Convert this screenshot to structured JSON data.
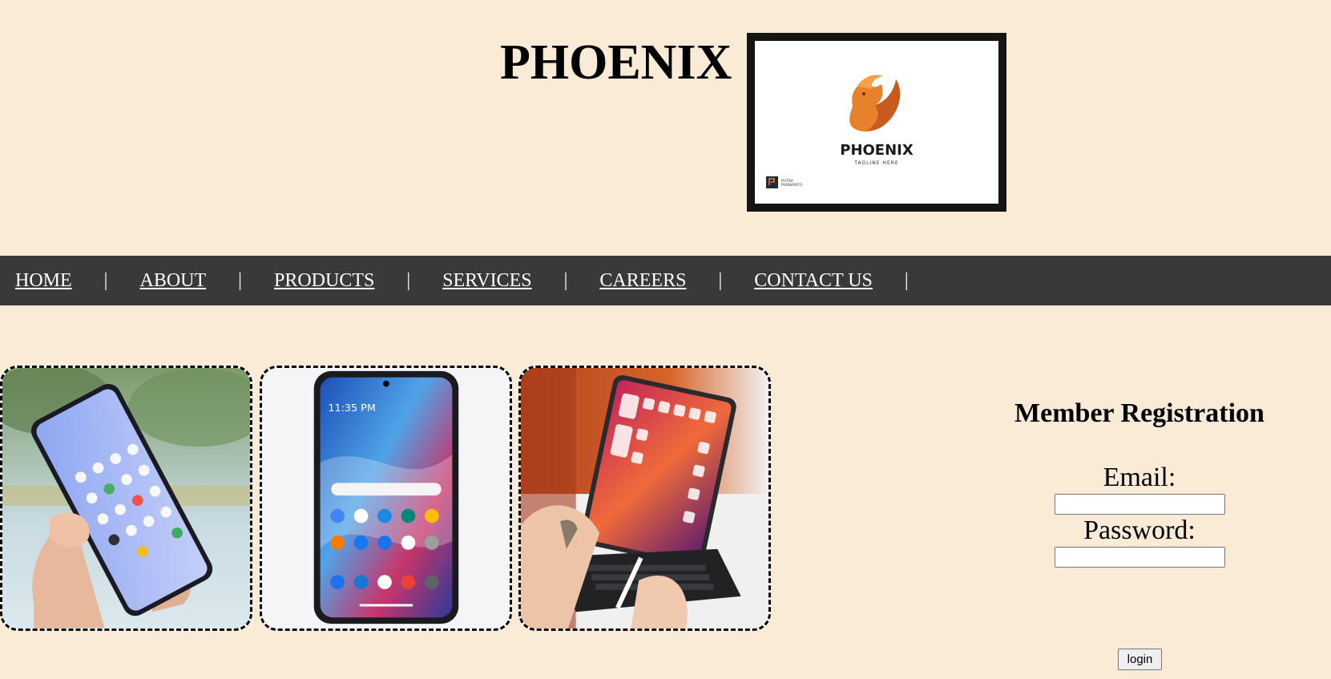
{
  "header": {
    "title": "PHOENIX",
    "logo": {
      "brand": "PHOENIX",
      "tagline": "TAGLINE HERE",
      "credit_line_1": "PUTRA",
      "credit_line_2": "PURWANTO",
      "accent_color": "#e8812c"
    }
  },
  "nav": {
    "separator": "|",
    "items": [
      {
        "label": "HOME"
      },
      {
        "label": "ABOUT"
      },
      {
        "label": "PRODUCTS"
      },
      {
        "label": "SERVICES"
      },
      {
        "label": "CAREERS"
      },
      {
        "label": "CONTACT US"
      }
    ]
  },
  "products": {
    "phone_1": {
      "icon": "smartphone-in-hand-photo"
    },
    "phone_2": {
      "icon": "smartphone-front-photo",
      "clock": "11:35 PM"
    },
    "tablet": {
      "icon": "tablet-with-keyboard-photo"
    }
  },
  "registration": {
    "title": "Member Registration",
    "email_label": "Email:",
    "email_value": "",
    "password_label": "Password:",
    "password_value": "",
    "login_label": "login"
  },
  "colors": {
    "page_background": "#faebd7",
    "nav_background": "#393939",
    "nav_text": "#ffffff"
  }
}
